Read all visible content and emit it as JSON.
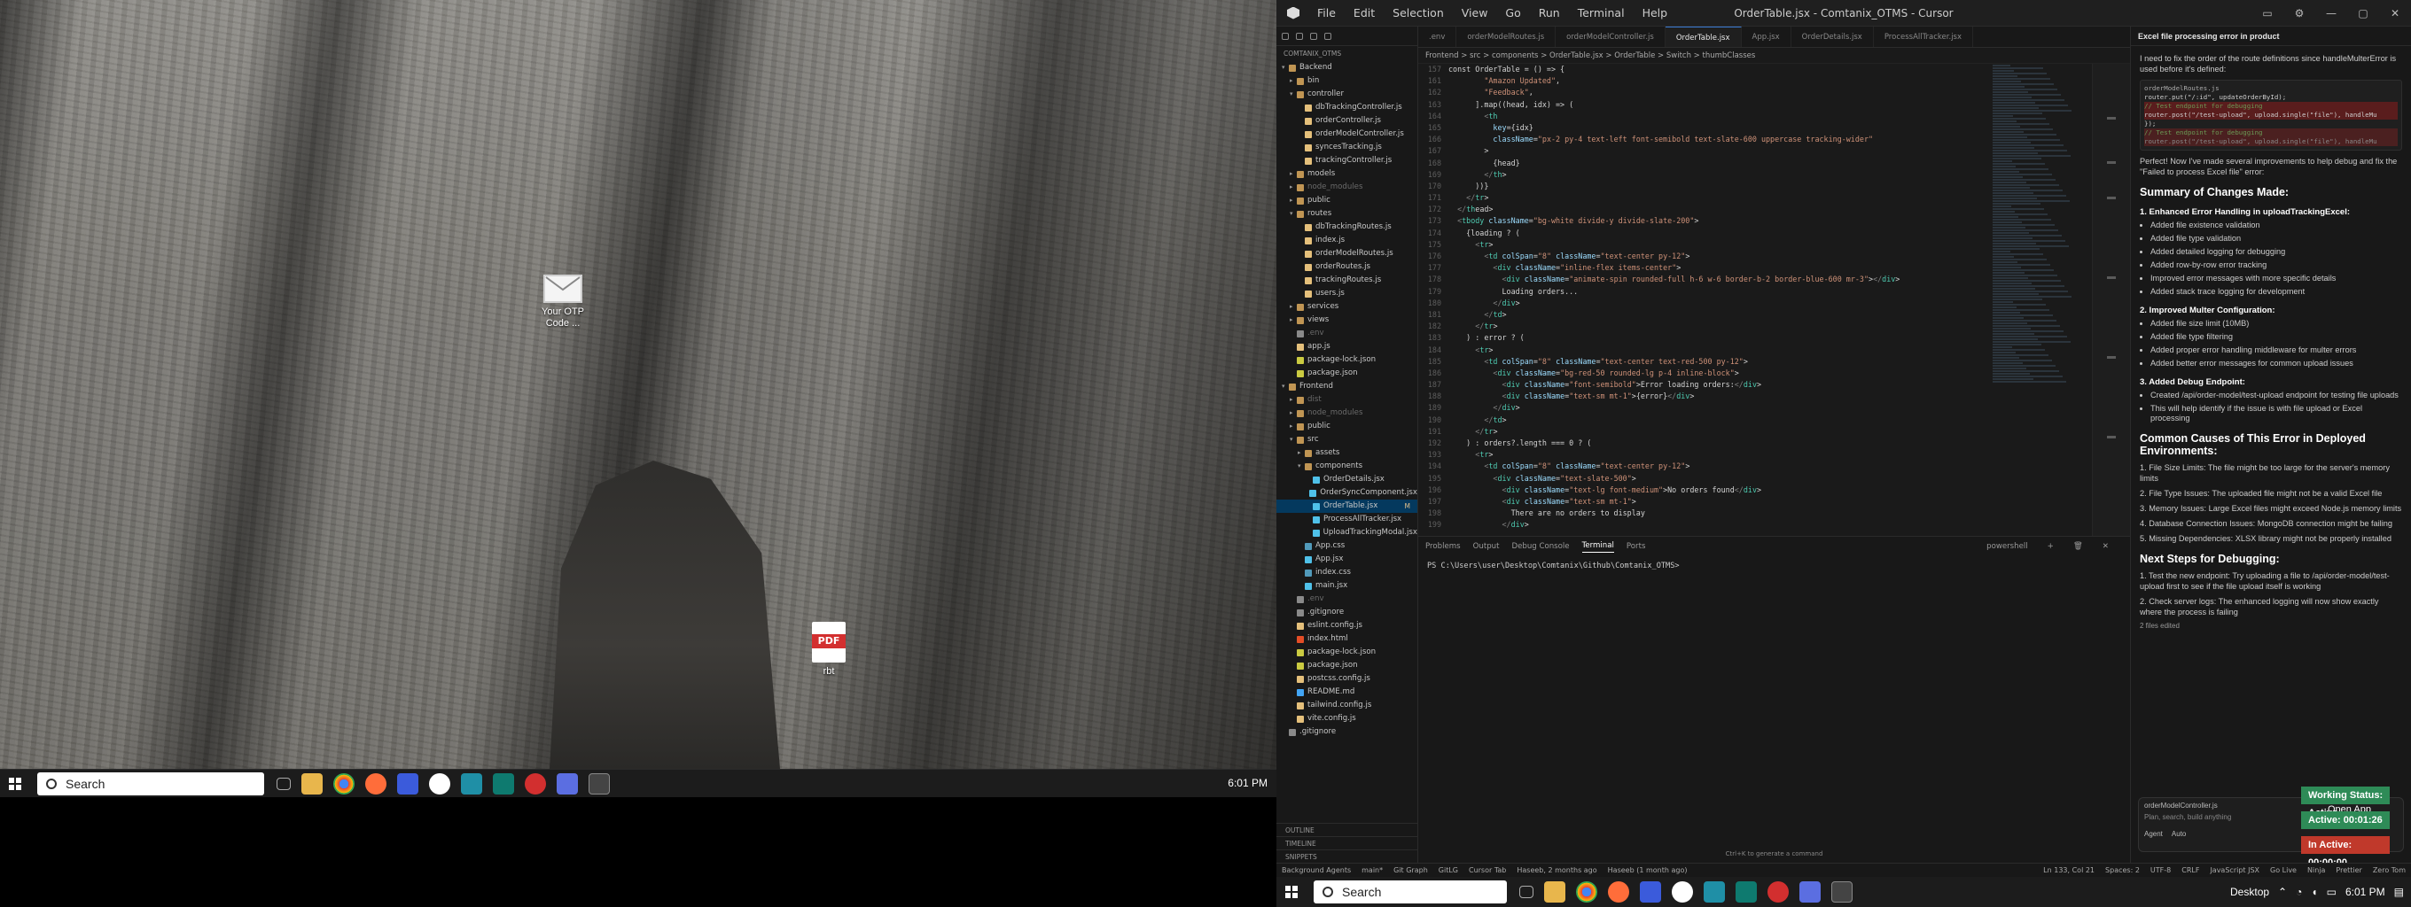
{
  "desktop": {
    "icons": [
      {
        "name": "mail",
        "label_line1": "Your OTP",
        "label_line2": "Code ..."
      },
      {
        "name": "pdf",
        "glyph": "PDF",
        "label_line1": "rbt",
        "label_line2": ""
      }
    ]
  },
  "taskbar_left": {
    "search_placeholder": "Search",
    "time": "6:01 PM"
  },
  "taskbar_right": {
    "search_placeholder": "Search",
    "desktop_label": "Desktop",
    "time": "6:01 PM"
  },
  "window": {
    "title": "OrderTable.jsx - Comtanix_OTMS - Cursor",
    "menus": [
      "File",
      "Edit",
      "Selection",
      "View",
      "Go",
      "Run",
      "Terminal",
      "Help"
    ]
  },
  "explorer": {
    "section_title": "COMTANIX_OTMS",
    "tree": [
      {
        "d": 0,
        "label": "Backend",
        "folder": true,
        "open": true
      },
      {
        "d": 1,
        "label": "bin",
        "folder": true
      },
      {
        "d": 1,
        "label": "controller",
        "folder": true,
        "open": true
      },
      {
        "d": 2,
        "label": "dbTrackingController.js"
      },
      {
        "d": 2,
        "label": "orderController.js"
      },
      {
        "d": 2,
        "label": "orderModelController.js"
      },
      {
        "d": 2,
        "label": "syncesTracking.js"
      },
      {
        "d": 2,
        "label": "trackingController.js"
      },
      {
        "d": 1,
        "label": "models",
        "folder": true
      },
      {
        "d": 1,
        "label": "node_modules",
        "folder": true,
        "dim": true
      },
      {
        "d": 1,
        "label": "public",
        "folder": true
      },
      {
        "d": 1,
        "label": "routes",
        "folder": true,
        "open": true
      },
      {
        "d": 2,
        "label": "dbTrackingRoutes.js"
      },
      {
        "d": 2,
        "label": "index.js"
      },
      {
        "d": 2,
        "label": "orderModelRoutes.js"
      },
      {
        "d": 2,
        "label": "orderRoutes.js"
      },
      {
        "d": 2,
        "label": "trackingRoutes.js"
      },
      {
        "d": 2,
        "label": "users.js"
      },
      {
        "d": 1,
        "label": "services",
        "folder": true
      },
      {
        "d": 1,
        "label": "views",
        "folder": true
      },
      {
        "d": 1,
        "label": ".env",
        "dim": true
      },
      {
        "d": 1,
        "label": "app.js"
      },
      {
        "d": 1,
        "label": "package-lock.json"
      },
      {
        "d": 1,
        "label": "package.json"
      },
      {
        "d": 0,
        "label": "Frontend",
        "folder": true,
        "open": true
      },
      {
        "d": 1,
        "label": "dist",
        "folder": true,
        "dim": true
      },
      {
        "d": 1,
        "label": "node_modules",
        "folder": true,
        "dim": true
      },
      {
        "d": 1,
        "label": "public",
        "folder": true
      },
      {
        "d": 1,
        "label": "src",
        "folder": true,
        "open": true
      },
      {
        "d": 2,
        "label": "assets",
        "folder": true
      },
      {
        "d": 2,
        "label": "components",
        "folder": true,
        "open": true
      },
      {
        "d": 3,
        "label": "OrderDetails.jsx"
      },
      {
        "d": 3,
        "label": "OrderSyncComponent.jsx"
      },
      {
        "d": 3,
        "label": "OrderTable.jsx",
        "sel": true,
        "badge": "M"
      },
      {
        "d": 3,
        "label": "ProcessAllTracker.jsx"
      },
      {
        "d": 3,
        "label": "UploadTrackingModal.jsx"
      },
      {
        "d": 2,
        "label": "App.css"
      },
      {
        "d": 2,
        "label": "App.jsx"
      },
      {
        "d": 2,
        "label": "index.css"
      },
      {
        "d": 2,
        "label": "main.jsx"
      },
      {
        "d": 1,
        "label": ".env",
        "dim": true
      },
      {
        "d": 1,
        "label": ".gitignore"
      },
      {
        "d": 1,
        "label": "eslint.config.js"
      },
      {
        "d": 1,
        "label": "index.html"
      },
      {
        "d": 1,
        "label": "package-lock.json"
      },
      {
        "d": 1,
        "label": "package.json"
      },
      {
        "d": 1,
        "label": "postcss.config.js"
      },
      {
        "d": 1,
        "label": "README.md"
      },
      {
        "d": 1,
        "label": "tailwind.config.js"
      },
      {
        "d": 1,
        "label": "vite.config.js"
      },
      {
        "d": 0,
        "label": ".gitignore"
      }
    ],
    "bottom_sections": [
      "OUTLINE",
      "TIMELINE",
      "SNIPPETS"
    ]
  },
  "editor": {
    "tabs": [
      ".env",
      "orderModelRoutes.js",
      "orderModelController.js",
      "OrderTable.jsx",
      "App.jsx",
      "OrderDetails.jsx",
      "ProcessAllTracker.jsx"
    ],
    "active_tab": "OrderTable.jsx",
    "breadcrumb": "Frontend > src > components > OrderTable.jsx > OrderTable > Switch > thumbClasses",
    "first_line": "const OrderTable = () => {"
  },
  "code_lines": [
    {
      "n": "161",
      "t": "        \"Amazon Updated\","
    },
    {
      "n": "162",
      "t": "        \"Feedback\","
    },
    {
      "n": "163",
      "t": "      ].map((head, idx) => ("
    },
    {
      "n": "164",
      "t": "        <th"
    },
    {
      "n": "165",
      "t": "          key={idx}"
    },
    {
      "n": "166",
      "t": "          className=\"px-2 py-4 text-left font-semibold text-slate-600 uppercase tracking-wider\""
    },
    {
      "n": "167",
      "t": "        >"
    },
    {
      "n": "168",
      "t": "          {head}"
    },
    {
      "n": "169",
      "t": "        </th>"
    },
    {
      "n": "170",
      "t": "      ))}"
    },
    {
      "n": "171",
      "t": "    </tr>"
    },
    {
      "n": "172",
      "t": "  </thead>"
    },
    {
      "n": "173",
      "t": "  <tbody className=\"bg-white divide-y divide-slate-200\">"
    },
    {
      "n": "174",
      "t": "    {loading ? ("
    },
    {
      "n": "175",
      "t": "      <tr>"
    },
    {
      "n": "176",
      "t": "        <td colSpan=\"8\" className=\"text-center py-12\">"
    },
    {
      "n": "177",
      "t": "          <div className=\"inline-flex items-center\">"
    },
    {
      "n": "178",
      "t": "            <div className=\"animate-spin rounded-full h-6 w-6 border-b-2 border-blue-600 mr-3\"></div>"
    },
    {
      "n": "179",
      "t": "            Loading orders..."
    },
    {
      "n": "180",
      "t": "          </div>"
    },
    {
      "n": "181",
      "t": "        </td>"
    },
    {
      "n": "182",
      "t": "      </tr>"
    },
    {
      "n": "183",
      "t": "    ) : error ? ("
    },
    {
      "n": "184",
      "t": "      <tr>"
    },
    {
      "n": "185",
      "t": "        <td colSpan=\"8\" className=\"text-center text-red-500 py-12\">"
    },
    {
      "n": "186",
      "t": "          <div className=\"bg-red-50 rounded-lg p-4 inline-block\">"
    },
    {
      "n": "187",
      "t": "            <div className=\"font-semibold\">Error loading orders:</div>"
    },
    {
      "n": "188",
      "t": "            <div className=\"text-sm mt-1\">{error}</div>"
    },
    {
      "n": "189",
      "t": "          </div>"
    },
    {
      "n": "190",
      "t": "        </td>"
    },
    {
      "n": "191",
      "t": "      </tr>"
    },
    {
      "n": "192",
      "t": "    ) : orders?.length === 0 ? ("
    },
    {
      "n": "193",
      "t": "      <tr>"
    },
    {
      "n": "194",
      "t": "        <td colSpan=\"8\" className=\"text-center py-12\">"
    },
    {
      "n": "195",
      "t": "          <div className=\"text-slate-500\">"
    },
    {
      "n": "196",
      "t": "            <div className=\"text-lg font-medium\">No orders found</div>"
    },
    {
      "n": "197",
      "t": "            <div className=\"text-sm mt-1\">"
    },
    {
      "n": "198",
      "t": "              There are no orders to display"
    },
    {
      "n": "199",
      "t": "            </div>"
    }
  ],
  "panel": {
    "tabs": [
      "Problems",
      "Output",
      "Debug Console",
      "Terminal",
      "Ports"
    ],
    "active": "Terminal",
    "shell": "powershell",
    "prompt": "PS C:\\Users\\user\\Desktop\\Comtanix\\Github\\Comtanix_OTMS>",
    "footer": "Ctrl+K to generate a command"
  },
  "chat": {
    "header": "Excel file processing error in product",
    "intro": "I need to fix the order of the route definitions since handleMulterError is used before it's defined:",
    "file_ref": "orderModelRoutes.js",
    "code1": [
      "router.put(\"/:id\", updateOrderById);",
      "// Test endpoint for debugging",
      "router.post(\"/test-upload\", upload.single(\"file\"), handleMu",
      "});",
      "// Test endpoint for debugging",
      "router.post(\"/test-upload\", upload.single(\"file\"), handleMu"
    ],
    "after": "Perfect! Now I've made several improvements to help debug and fix the \"Failed to process Excel file\" error:",
    "summary_title": "Summary of Changes Made:",
    "s1_title": "1. Enhanced Error Handling in uploadTrackingExcel:",
    "s1": [
      "Added file existence validation",
      "Added file type validation",
      "Added detailed logging for debugging",
      "Added row-by-row error tracking",
      "Improved error messages with more specific details",
      "Added stack trace logging for development"
    ],
    "s2_title": "2. Improved Multer Configuration:",
    "s2": [
      "Added file size limit (10MB)",
      "Added file type filtering",
      "Added proper error handling middleware for multer errors",
      "Added better error messages for common upload issues"
    ],
    "s3_title": "3. Added Debug Endpoint:",
    "s3": [
      "Created /api/order-model/test-upload endpoint for testing file uploads",
      "This will help identify if the issue is with file upload or Excel processing"
    ],
    "causes_title": "Common Causes of This Error in Deployed Environments:",
    "causes": [
      "1. File Size Limits: The file might be too large for the server's memory limits",
      "2. File Type Issues: The uploaded file might not be a valid Excel file",
      "3. Memory Issues: Large Excel files might exceed Node.js memory limits",
      "4. Database Connection Issues: MongoDB connection might be failing",
      "5. Missing Dependencies: XLSX library might not be properly installed"
    ],
    "next_title": "Next Steps for Debugging:",
    "next": [
      "1. Test the new endpoint: Try uploading a file to /api/order-model/test-upload first to see if the file upload itself is working",
      "2. Check server logs: The enhanced logging will now show exactly where the process is failing"
    ],
    "files_edited": "2 files edited",
    "input_file": "orderModelController.js",
    "input_placeholder": "Plan, search, build anything",
    "agent_label": "Agent",
    "mode_label": "Auto"
  },
  "timers": [
    {
      "label": "Working Status: Active",
      "color": "#2e8b57"
    },
    {
      "label": "Active: 00:01:26",
      "color": "#2e8b57"
    },
    {
      "label": "In Active: 00:00:00",
      "color": "#c0392b"
    }
  ],
  "open_app": "Open App",
  "statusbar": {
    "left": [
      "Background Agents",
      "main*",
      "Git Graph",
      "GitLG",
      "Cursor Tab",
      "Haseeb, 2 months ago",
      "Haseeb (1 month ago)"
    ],
    "right": [
      "Ln 133, Col 21",
      "Spaces: 2",
      "UTF-8",
      "CRLF",
      "JavaScript JSX",
      "Go Live",
      "Ninja",
      "Prettier",
      "Zero Tom"
    ]
  }
}
